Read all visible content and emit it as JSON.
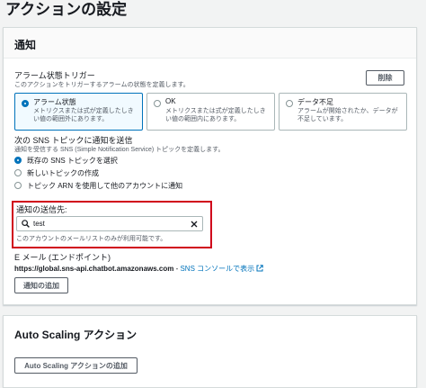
{
  "page_title": "アクションの設定",
  "notification": {
    "header": "通知",
    "remove_button": "削除",
    "alarm_state_trigger": {
      "label": "アラーム状態トリガー",
      "description": "このアクションをトリガーするアラームの状態を定義します。",
      "options": [
        {
          "title": "アラーム状態",
          "desc": "メトリクスまたは式が定義したしきい値の範囲外にあります。",
          "selected": true
        },
        {
          "title": "OK",
          "desc": "メトリクスまたは式が定義したしきい値の範囲内にあります。",
          "selected": false
        },
        {
          "title": "データ不足",
          "desc": "アラームが開始されたか、データが不足しています。",
          "selected": false
        }
      ]
    },
    "sns_topic": {
      "label": "次の SNS トピックに通知を送信",
      "description": "通知を受信する SNS (Simple Notification Service) トピックを定義します。",
      "options": [
        {
          "label": "既存の SNS トピックを選択",
          "selected": true
        },
        {
          "label": "新しいトピックの作成",
          "selected": false
        },
        {
          "label": "トピック ARN を使用して他のアカウントに通知",
          "selected": false
        }
      ]
    },
    "send_to": {
      "label": "通知の送信先:",
      "value": "test",
      "hint": "このアカウントのメールリストのみが利用可能です。"
    },
    "email_endpoint": {
      "label": "E メール (エンドポイント)",
      "value": "https://global.sns-api.chatbot.amazonaws.com",
      "separator": " - ",
      "link_text": "SNS コンソールで表示"
    },
    "add_notification_button": "通知の追加"
  },
  "autoscaling": {
    "header": "Auto Scaling アクション",
    "add_button": "Auto Scaling アクションの追加"
  },
  "colors": {
    "accent": "#0073bb",
    "highlight": "#d0021b"
  }
}
